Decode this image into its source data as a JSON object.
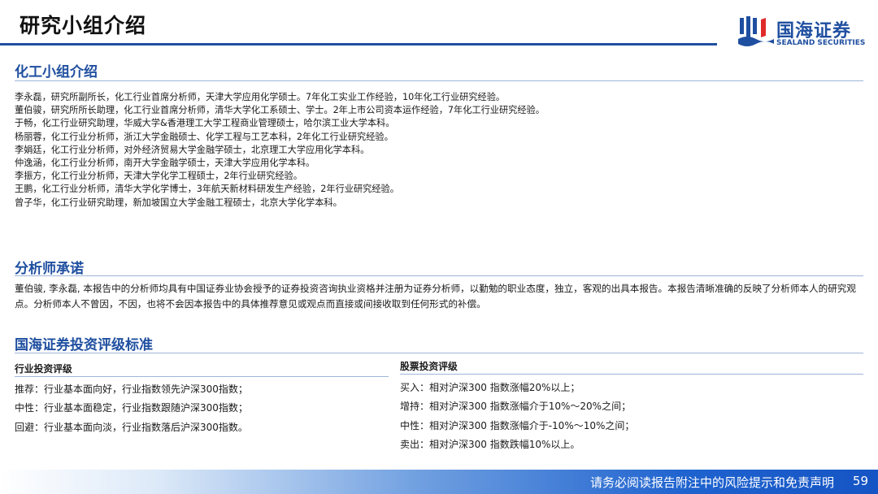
{
  "header": {
    "title": "研究小组介绍",
    "logo_cn": "国海证券",
    "logo_en": "SEALAND SECURITIES",
    "brand_color": "#1f4fa0"
  },
  "team": {
    "heading": "化工小组介绍",
    "members": [
      "李永磊，研究所副所长，化工行业首席分析师，天津大学应用化学硕士。7年化工实业工作经验，10年化工行业研究经验。",
      "董伯骏，研究所所长助理，化工行业首席分析师，清华大学化工系硕士、学士。2年上市公司资本运作经验，7年化工行业研究经验。",
      "于畅，化工行业研究助理，华威大学&香港理工大学工程商业管理硕士，哈尔滨工业大学本科。",
      "杨丽蓉，化工行业分析师，浙江大学金融硕士、化学工程与工艺本科，2年化工行业研究经验。",
      "李娟廷，化工行业分析师，对外经济贸易大学金融学硕士，北京理工大学应用化学本科。",
      "仲逸涵，化工行业分析师，南开大学金融学硕士，天津大学应用化学本科。",
      "李振方，化工行业分析师，天津大学化学工程硕士，2年行业研究经验。",
      "王鹏，化工行业分析师，清华大学化学博士，3年航天新材料研发生产经验，2年行业研究经验。",
      "曾子华，化工行业研究助理，新加坡国立大学金融工程硕士，北京大学化学本科。"
    ]
  },
  "commitment": {
    "heading": "分析师承诺",
    "text": "董伯骏, 李永磊, 本报告中的分析师均具有中国证券业协会授予的证券投资咨询执业资格并注册为证券分析师，以勤勉的职业态度，独立，客观的出具本报告。本报告清晰准确的反映了分析师本人的研究观点。分析师本人不曾因，不因，也将不会因本报告中的具体推荐意见或观点而直接或间接收取到任何形式的补偿。"
  },
  "rating": {
    "heading": "国海证券投资评级标准",
    "industry": {
      "title": "行业投资评级",
      "items": [
        "推荐：行业基本面向好，行业指数领先沪深300指数；",
        "中性：行业基本面稳定，行业指数跟随沪深300指数；",
        "回避：行业基本面向淡，行业指数落后沪深300指数。"
      ]
    },
    "stock": {
      "title": "股票投资评级",
      "items": [
        "买入：相对沪深300 指数涨幅20%以上；",
        "增持：相对沪深300 指数涨幅介于10%～20%之间；",
        "中性：相对沪深300 指数涨幅介于-10%～10%之间；",
        "卖出：相对沪深300 指数跌幅10%以上。"
      ]
    }
  },
  "footer": {
    "disclaimer": "请务必阅读报告附注中的风险提示和免责声明",
    "page_number": "59"
  }
}
